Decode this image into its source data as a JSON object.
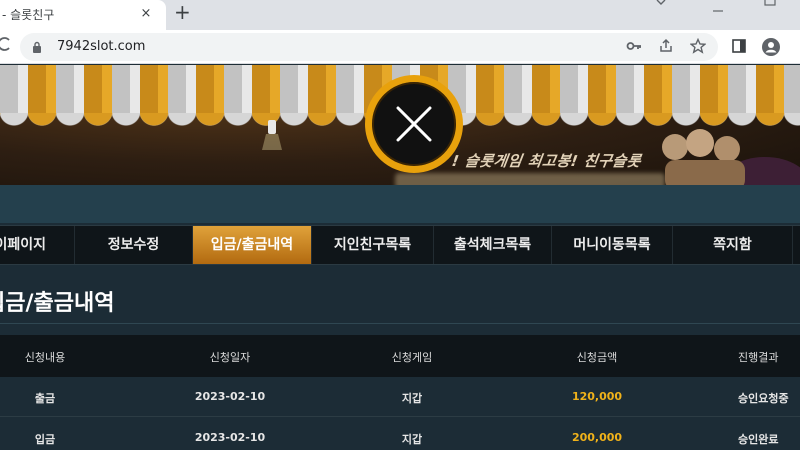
{
  "browser": {
    "tab_title": "- 슬롯친구",
    "tab_close": "×",
    "new_tab": "+",
    "url": "7942slot.com"
  },
  "banner": {
    "slogan": "! 슬롯게임 최고봉! 친구슬롯",
    "close_symbol": "×"
  },
  "nav": {
    "items": [
      {
        "label": "마이페이지"
      },
      {
        "label": "정보수정"
      },
      {
        "label": "입금/출금내역",
        "active": true
      },
      {
        "label": "지인친구목록"
      },
      {
        "label": "출석체크목록"
      },
      {
        "label": "머니이동목록"
      },
      {
        "label": "쪽지함"
      }
    ]
  },
  "section": {
    "title": "입금/출금내역"
  },
  "table": {
    "headers": [
      "신청내용",
      "신청일자",
      "신청게임",
      "신청금액",
      "진행결과"
    ],
    "rows": [
      {
        "type": "출금",
        "date": "2023-02-10",
        "game": "지갑",
        "amount": "120,000",
        "status": "승인요청중"
      },
      {
        "type": "입금",
        "date": "2023-02-10",
        "game": "지갑",
        "amount": "200,000",
        "status": "승인완료"
      }
    ]
  },
  "colors": {
    "accent": "#e8a10c",
    "amount": "#f0b21a",
    "nav_active": "#c8801e"
  }
}
